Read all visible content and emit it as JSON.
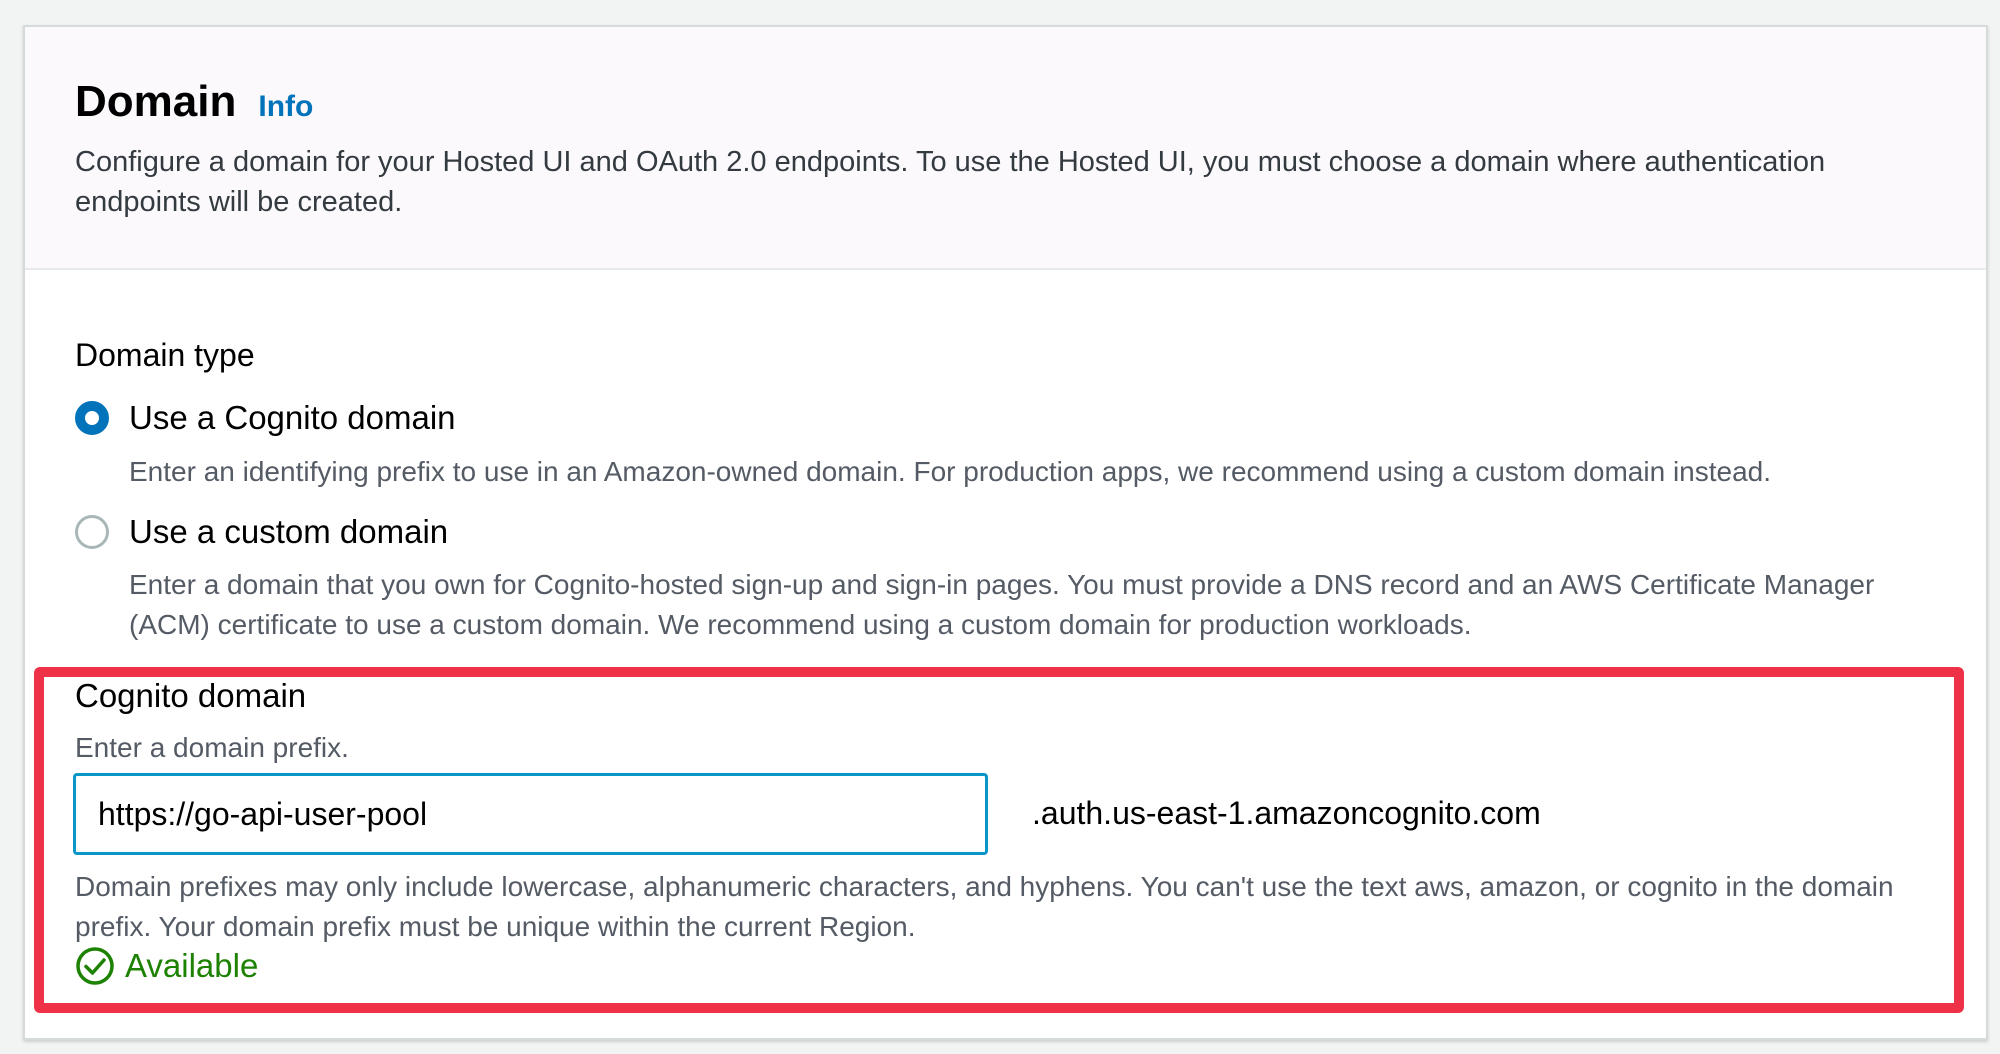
{
  "header": {
    "title": "Domain",
    "info_link": "Info",
    "description": "Configure a domain for your Hosted UI and OAuth 2.0 endpoints. To use the Hosted UI, you must choose a domain where authentication endpoints will be created."
  },
  "domain_type": {
    "label": "Domain type",
    "options": [
      {
        "label": "Use a Cognito domain",
        "description": "Enter an identifying prefix to use in an Amazon-owned domain. For production apps, we recommend using a custom domain instead.",
        "selected": true
      },
      {
        "label": "Use a custom domain",
        "description": "Enter a domain that you own for Cognito-hosted sign-up and sign-in pages. You must provide a DNS record and an AWS Certificate Manager (ACM) certificate to use a custom domain. We recommend using a custom domain for production workloads.",
        "selected": false
      }
    ]
  },
  "cognito_domain": {
    "label": "Cognito domain",
    "hint": "Enter a domain prefix.",
    "value": "https://go-api-user-pool",
    "suffix": ".auth.us-east-1.amazoncognito.com",
    "constraint": "Domain prefixes may only include lowercase, alphanumeric characters, and hyphens. You can't use the text aws, amazon, or cognito in the domain prefix. Your domain prefix must be unique within the current Region.",
    "status": "Available",
    "status_icon": "check-circle-icon"
  },
  "colors": {
    "accent": "#0073bb",
    "input_border": "#0a97c8",
    "success": "#1d8102",
    "highlight": "#ee3147"
  }
}
